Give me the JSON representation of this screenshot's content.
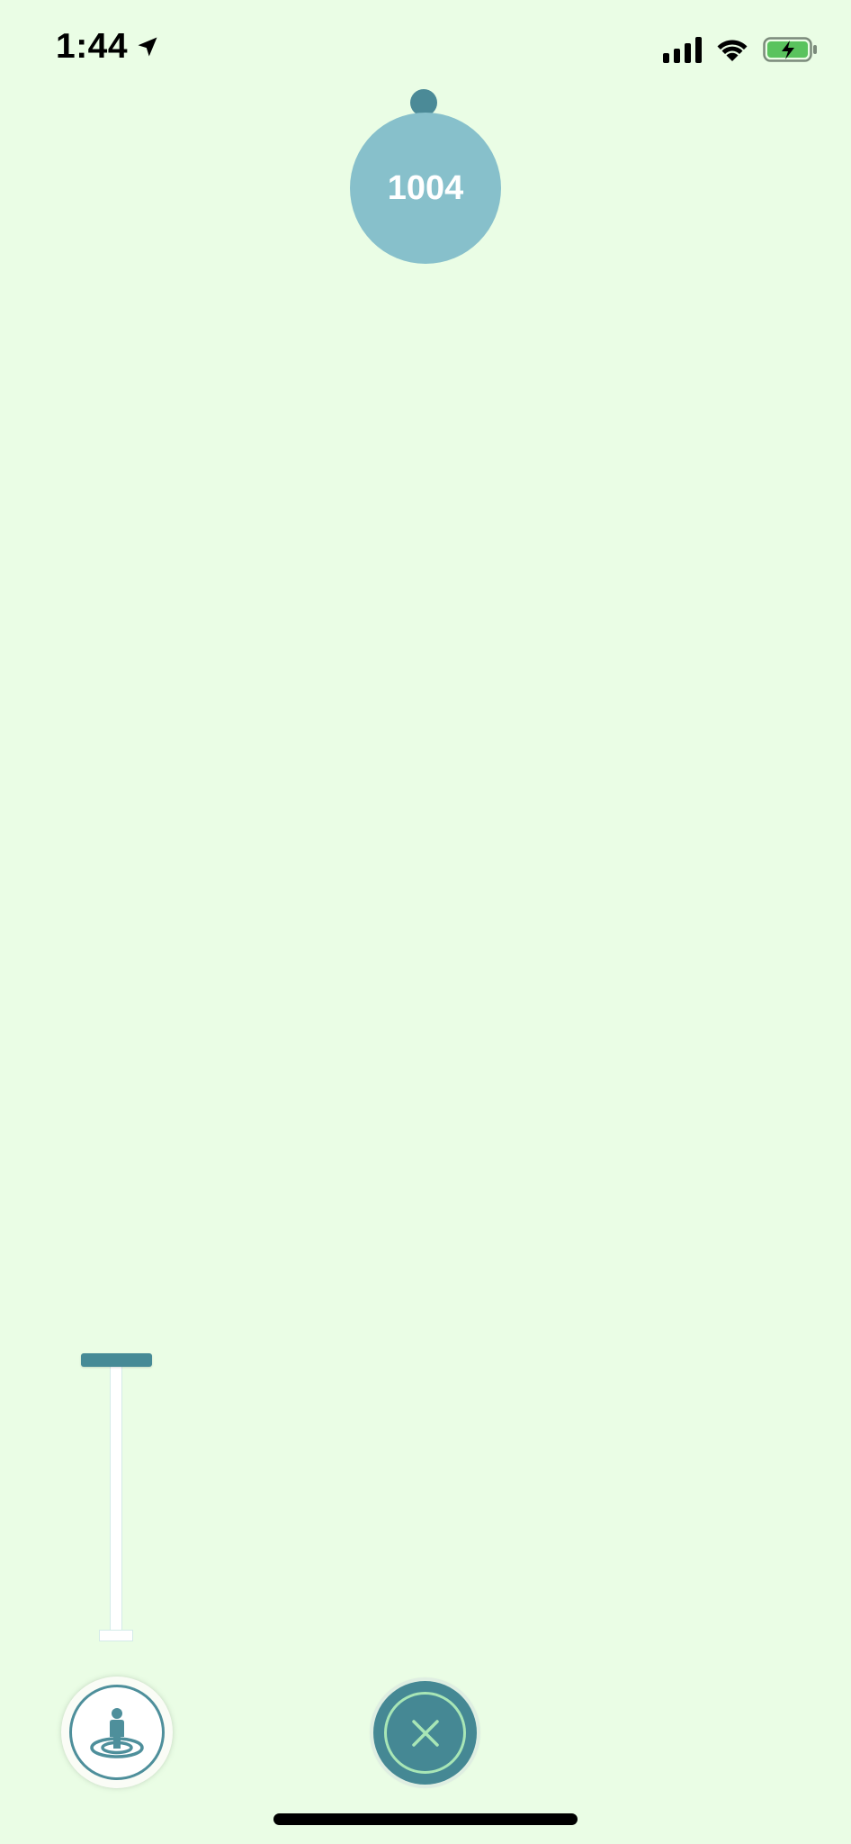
{
  "status_bar": {
    "time": "1:44",
    "location_icon": "location-arrow-icon",
    "signal_icon": "cellular-signal-icon",
    "wifi_icon": "wifi-icon",
    "battery_icon": "battery-charging-icon"
  },
  "counter": {
    "value": "1004"
  },
  "zoom_slider": {
    "handle_icon": "slider-handle"
  },
  "buttons": {
    "avatar_icon": "person-ripple-icon",
    "close_icon": "close-icon"
  },
  "colors": {
    "background": "#eafde5",
    "accent": "#458894",
    "bubble": "#87c0cb",
    "close_ring": "#a8e6b6"
  }
}
